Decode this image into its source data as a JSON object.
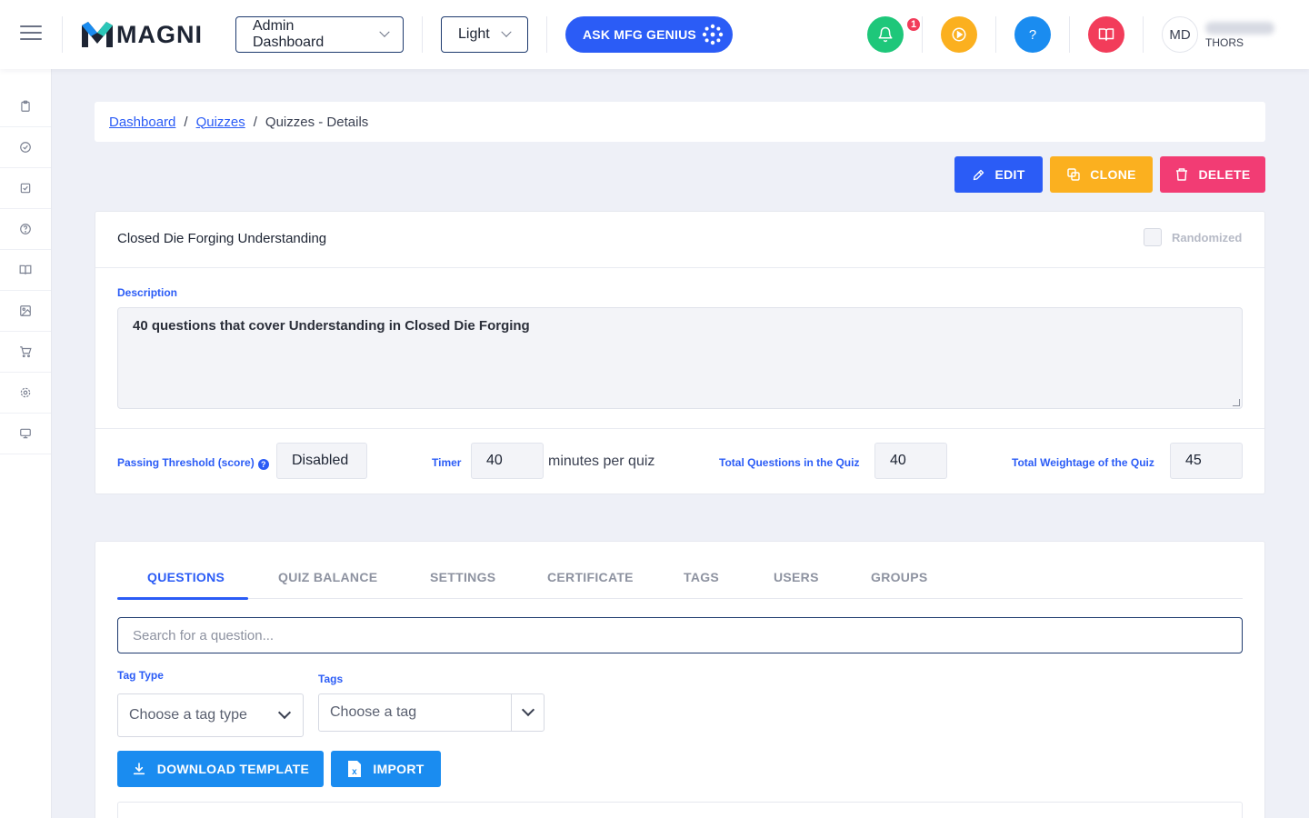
{
  "header": {
    "logo_text": "MAGNI",
    "dashboard_select": "Admin Dashboard",
    "theme_select": "Light",
    "genius_button": "ASK MFG GENIUS",
    "notification_count": "1",
    "avatar_initials": "MD",
    "user_org": "THORS",
    "icons": [
      "menu-icon",
      "bell-icon",
      "play-circle-icon",
      "help-icon",
      "book-icon"
    ],
    "colors": {
      "bell": "#1ec77a",
      "play": "#fbb01f",
      "help": "#1a8cf0",
      "book": "#f23c5a",
      "primary": "#2b5cf6"
    }
  },
  "sidebar": {
    "icons": [
      "clipboard-icon",
      "check-circle-icon",
      "check-square-icon",
      "question-circle-icon",
      "book-open-icon",
      "image-icon",
      "cart-icon",
      "gear-icon",
      "monitor-icon"
    ]
  },
  "breadcrumb": {
    "items": [
      "Dashboard",
      "Quizzes",
      "Quizzes - Details"
    ],
    "separator": "/"
  },
  "actions": {
    "edit": "EDIT",
    "clone": "CLONE",
    "delete": "DELETE",
    "colors": {
      "edit": "#2b5cf6",
      "clone": "#fbb01f",
      "delete": "#f23c74"
    }
  },
  "quiz": {
    "title": "Closed Die Forging Understanding",
    "randomized_label": "Randomized",
    "description_label": "Description",
    "description": "40 questions that cover Understanding in Closed Die Forging",
    "passing_label": "Passing Threshold (score)",
    "passing_value": "Disabled",
    "timer_label": "Timer",
    "timer_value": "40",
    "timer_suffix": "minutes per quiz",
    "total_questions_label": "Total Questions in the Quiz",
    "total_questions_value": "40",
    "total_weightage_label": "Total Weightage of the Quiz",
    "total_weightage_value": "45"
  },
  "tabs": {
    "items": [
      "QUESTIONS",
      "QUIZ BALANCE",
      "SETTINGS",
      "CERTIFICATE",
      "TAGS",
      "USERS",
      "GROUPS"
    ],
    "active": "QUESTIONS"
  },
  "questions": {
    "search_placeholder": "Search for a question...",
    "tag_type_label": "Tag Type",
    "tag_type_placeholder": "Choose a tag type",
    "tags_label": "Tags",
    "tags_placeholder": "Choose a tag",
    "download_button": "DOWNLOAD TEMPLATE",
    "import_button": "IMPORT"
  }
}
